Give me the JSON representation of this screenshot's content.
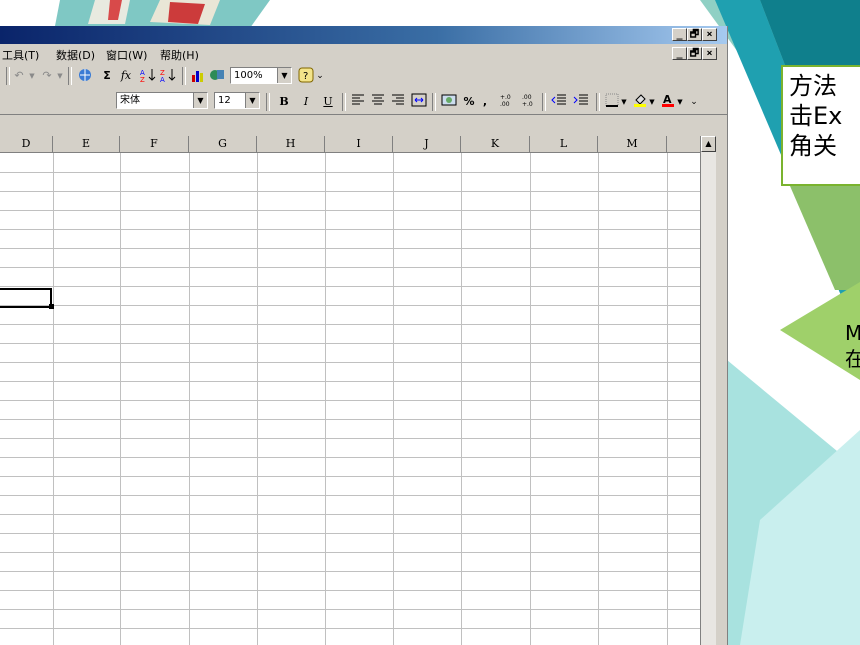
{
  "menu": {
    "tools": "工具(T)",
    "data": "数据(D)",
    "window": "窗口(W)",
    "help": "帮助(H)"
  },
  "window_buttons": {
    "minimize": "_",
    "restore": "🗗",
    "close": "×"
  },
  "toolbar": {
    "autosum": "Σ",
    "function": "fx",
    "zoom": "100%",
    "font": "宋体",
    "size": "12",
    "bold": "B",
    "italic": "I",
    "underline": "U",
    "percent": "%",
    "comma": ","
  },
  "columns": [
    "D",
    "E",
    "F",
    "G",
    "H",
    "I",
    "J",
    "K",
    "L",
    "M",
    ""
  ],
  "note": {
    "line1": "方法",
    "line2": "击Ex",
    "line3": "角关"
  },
  "arrow_note": {
    "line1": "M",
    "line2": "在"
  },
  "colors": {
    "accent_green": "#7ab32e",
    "teal": "#2fa6b4",
    "titlebar": "#0a246a"
  }
}
